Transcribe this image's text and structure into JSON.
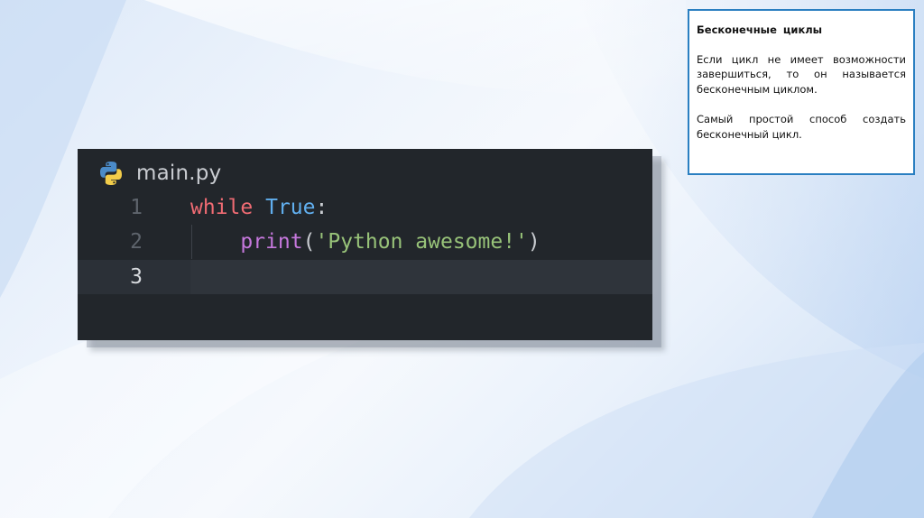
{
  "editor": {
    "tab_title": "main.py",
    "tab_icon": "python-logo-icon",
    "lines": [
      {
        "number": "1",
        "tokens": [
          {
            "t": "while",
            "k": "kw"
          },
          {
            "t": " ",
            "k": "punc"
          },
          {
            "t": "True",
            "k": "cst"
          },
          {
            "t": ":",
            "k": "punc"
          }
        ]
      },
      {
        "number": "2",
        "tokens": [
          {
            "t": "    ",
            "k": "punc"
          },
          {
            "t": "print",
            "k": "fn"
          },
          {
            "t": "(",
            "k": "punc"
          },
          {
            "t": "'Python awesome!'",
            "k": "str"
          },
          {
            "t": ")",
            "k": "punc"
          }
        ]
      },
      {
        "number": "3",
        "tokens": []
      }
    ],
    "current_line": 3
  },
  "note": {
    "title": "Бесконечные  циклы",
    "paragraph1": "Если цикл не имеет возможности завершиться, то он называется бесконечным циклом.",
    "paragraph2": "Самый простой способ создать бесконечный цикл."
  },
  "colors": {
    "editor_bg": "#22262b",
    "keyword": "#ef6b73",
    "constant": "#61afef",
    "function": "#c678dd",
    "string": "#98c379",
    "note_border": "#2a7fc1"
  }
}
